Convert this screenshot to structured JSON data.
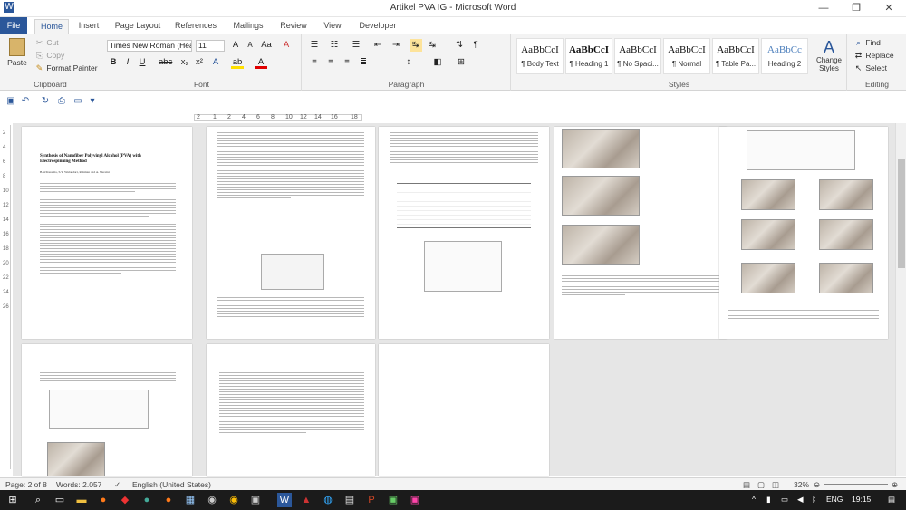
{
  "window": {
    "title": "Artikel PVA IG - Microsoft Word"
  },
  "tabs": [
    "File",
    "Home",
    "Insert",
    "Page Layout",
    "References",
    "Mailings",
    "Review",
    "View",
    "Developer"
  ],
  "clipboard": {
    "paste": "Paste",
    "cut": "Cut",
    "copy": "Copy",
    "format_painter": "Format Painter",
    "label": "Clipboard"
  },
  "font": {
    "name": "Times New Roman (Hea",
    "size": "11",
    "label": "Font"
  },
  "paragraph": {
    "label": "Paragraph"
  },
  "styles": {
    "label": "Styles",
    "items": [
      {
        "sample": "AaBbCcI",
        "name": "¶ Body Text"
      },
      {
        "sample": "AaBbCcI",
        "name": "¶ Heading 1"
      },
      {
        "sample": "AaBbCcI",
        "name": "¶ No Spaci..."
      },
      {
        "sample": "AaBbCcI",
        "name": "¶ Normal"
      },
      {
        "sample": "AaBbCcI",
        "name": "¶ Table Pa..."
      },
      {
        "sample": "AaBbCc",
        "name": "Heading 2"
      }
    ],
    "change_styles": "Change Styles"
  },
  "editing": {
    "label": "Editing",
    "find": "Find",
    "replace": "Replace",
    "select": "Select"
  },
  "ruler": {
    "ticks": [
      "2",
      "1",
      "2",
      "4",
      "6",
      "8",
      "10",
      "12",
      "14",
      "16",
      "18"
    ]
  },
  "vruler": {
    "ticks": [
      "2",
      "4",
      "6",
      "8",
      "10",
      "12",
      "14",
      "16",
      "18",
      "20",
      "22",
      "24",
      "26"
    ]
  },
  "doc": {
    "paper_title": "Synthesis of Nanofiber Polyvinyl Alcohol (PVA) with Electrospinning Method",
    "authors": "B.W.Kusuma, S.Y. Wulandari, Rahman and A. Nuraini"
  },
  "status": {
    "page": "Page: 2 of 8",
    "words": "Words: 2.057",
    "language": "English (United States)",
    "zoom": "32%"
  },
  "taskbar": {
    "lang": "ENG",
    "time": "19:15"
  }
}
